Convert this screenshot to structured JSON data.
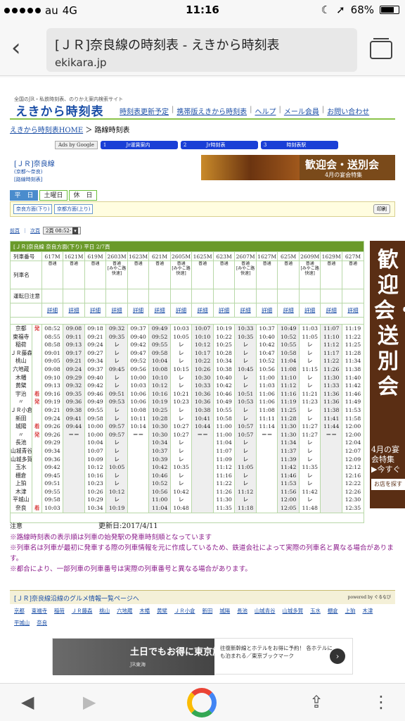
{
  "status": {
    "carrier": "au",
    "network": "4G",
    "time": "11:16",
    "battery": "68%",
    "battery_level": 0.68
  },
  "browser": {
    "title": "[ＪＲ]奈良線の時刻表 - えきから時刻表",
    "url": "ekikara.jp"
  },
  "site": {
    "tagline": "全国のJR・私鉄時刻表、のりかえ案内検索サイト",
    "logo": "えきから時刻表",
    "nav": [
      "時刻表更新予定",
      "携帯版えきから時刻表",
      "ヘルプ",
      "メール会員",
      "お問い合わせ"
    ],
    "breadcrumb_home": "えきから時刻表HOME",
    "breadcrumb_sep": "＞",
    "breadcrumb_current": "路線時刻表",
    "ads_by": "Ads by Google",
    "ad_links": [
      "Jr運賃案内",
      "Jr時刻表",
      "時刻表駅"
    ],
    "ad_link_nums": [
      "1",
      "2",
      "3"
    ],
    "line_name": "[ＪＲ]奈良線",
    "line_sub": "(京都～奈良)",
    "line_map": "[路線時刻表]",
    "banner_title": "歓迎会・送別会",
    "banner_sub": "4月の宴会特集",
    "day_tabs": [
      "平　日",
      "土曜日",
      "休　日"
    ],
    "dir_buttons": [
      "奈良方面(下り)",
      "京都方面(上り)"
    ],
    "print": "印刷",
    "pager_prev": "前頁",
    "pager_sep": "｜",
    "pager_next": "次頁",
    "pager_select": "2頁 08:52-"
  },
  "timetable": {
    "header": "[ＪＲ]奈良線 奈良方面(下り) 平日 2/7頁",
    "row_labels": {
      "train_no": "列車番号",
      "train_name": "列車名",
      "notice": "運転日注意",
      "detail": ""
    },
    "trains": [
      {
        "no": "617M",
        "type": "普通",
        "name": "",
        "detail": "詳細"
      },
      {
        "no": "1621M",
        "type": "普通",
        "name": "",
        "detail": "詳細"
      },
      {
        "no": "619M",
        "type": "普通",
        "name": "",
        "detail": "詳細"
      },
      {
        "no": "2603M",
        "type": "普通",
        "name": "[みやこ路快速]",
        "detail": "詳細"
      },
      {
        "no": "1623M",
        "type": "普通",
        "name": "",
        "detail": "詳細"
      },
      {
        "no": "621M",
        "type": "普通",
        "name": "",
        "detail": "詳細"
      },
      {
        "no": "2605M",
        "type": "普通",
        "name": "[みやこ路快速]",
        "detail": "詳細"
      },
      {
        "no": "1625M",
        "type": "普通",
        "name": "",
        "detail": "詳細"
      },
      {
        "no": "623M",
        "type": "普通",
        "name": "",
        "detail": "詳細"
      },
      {
        "no": "2607M",
        "type": "普通",
        "name": "[みやこ路快速]",
        "detail": "詳細"
      },
      {
        "no": "1627M",
        "type": "普通",
        "name": "",
        "detail": "詳細"
      },
      {
        "no": "625M",
        "type": "普通",
        "name": "",
        "detail": "詳細"
      },
      {
        "no": "2609M",
        "type": "普通",
        "name": "[みやこ路快速]",
        "detail": "詳細"
      },
      {
        "no": "1629M",
        "type": "普通",
        "name": "",
        "detail": "詳細"
      },
      {
        "no": "627M",
        "type": "普通",
        "name": "",
        "detail": "詳細"
      }
    ],
    "stations": [
      "京都",
      "東福寺",
      "稲荷",
      "ＪＲ藤森",
      "桃山",
      "六地蔵",
      "木幡",
      "黄檗",
      "宇治",
      "〃",
      "ＪＲ小倉",
      "新田",
      "城陽",
      "〃",
      "長池",
      "山城青谷",
      "山城多賀",
      "玉水",
      "棚倉",
      "上狛",
      "木津",
      "平城山",
      "奈良"
    ],
    "marks": [
      "発",
      "",
      "",
      "",
      "",
      "",
      "",
      "",
      "着",
      "発",
      "",
      "",
      "着",
      "発",
      "",
      "",
      "",
      "",
      "",
      "",
      "",
      "",
      "着"
    ],
    "times": [
      [
        "08:52",
        "08:55",
        "08:58",
        "09:01",
        "09:05",
        "09:08",
        "09:10",
        "09:13",
        "09:16",
        "09:19",
        "09:21",
        "09:24",
        "09:26",
        "09:26",
        "09:29",
        "09:34",
        "09:36",
        "09:42",
        "09:45",
        "09:51",
        "09:55",
        "09:58",
        "10:03"
      ],
      [
        "09:08",
        "09:11",
        "09:13",
        "09:17",
        "09:21",
        "09:24",
        "09:29",
        "09:32",
        "09:35",
        "09:36",
        "09:38",
        "09:41",
        "09:44",
        "＝＝",
        "",
        "",
        "",
        "",
        "",
        "",
        "",
        "",
        ""
      ],
      [
        "09:18",
        "09:21",
        "09:24",
        "09:27",
        "09:34",
        "09:37",
        "09:40",
        "09:42",
        "09:46",
        "09:49",
        "09:55",
        "09:58",
        "10:00",
        "10:00",
        "10:04",
        "10:07",
        "10:09",
        "10:12",
        "10:16",
        "10:23",
        "10:26",
        "10:29",
        "10:34"
      ],
      [
        "09:32",
        "09:35",
        "レ",
        "レ",
        "レ",
        "09:45",
        "レ",
        "レ",
        "09:51",
        "09:53",
        "レ",
        "レ",
        "09:57",
        "09:57",
        "レ",
        "レ",
        "レ",
        "10:05",
        "レ",
        "レ",
        "10:12",
        "レ",
        "10:19"
      ],
      [
        "09:37",
        "09:40",
        "09:42",
        "09:47",
        "09:52",
        "09:56",
        "10:00",
        "10:03",
        "10:06",
        "10:06",
        "10:08",
        "10:11",
        "10:14",
        "＝＝",
        "",
        "",
        "",
        "",
        "",
        "",
        "",
        "",
        ""
      ],
      [
        "09:49",
        "09:52",
        "09:55",
        "09:58",
        "10:04",
        "10:08",
        "10:10",
        "10:12",
        "10:16",
        "10:19",
        "10:25",
        "10:28",
        "10:30",
        "10:30",
        "10:34",
        "10:37",
        "10:39",
        "10:42",
        "10:46",
        "10:52",
        "10:56",
        "11:00",
        "11:04"
      ],
      [
        "10:03",
        "10:05",
        "レ",
        "レ",
        "レ",
        "10:15",
        "レ",
        "レ",
        "10:21",
        "10:23",
        "レ",
        "レ",
        "10:27",
        "10:27",
        "レ",
        "レ",
        "レ",
        "10:35",
        "レ",
        "レ",
        "10:42",
        "レ",
        "10:48"
      ],
      [
        "10:07",
        "10:10",
        "10:12",
        "10:17",
        "10:22",
        "10:26",
        "10:30",
        "10:33",
        "10:36",
        "10:36",
        "10:38",
        "10:41",
        "10:44",
        "＝＝",
        "",
        "",
        "",
        "",
        "",
        "",
        "",
        "",
        ""
      ],
      [
        "10:19",
        "10:22",
        "10:25",
        "10:28",
        "10:34",
        "10:38",
        "10:40",
        "10:42",
        "10:46",
        "10:49",
        "10:55",
        "10:58",
        "11:00",
        "11:00",
        "11:04",
        "11:07",
        "11:09",
        "11:12",
        "11:16",
        "11:22",
        "11:26",
        "11:30",
        "11:35"
      ],
      [
        "10:33",
        "10:35",
        "レ",
        "レ",
        "レ",
        "10:45",
        "レ",
        "レ",
        "10:51",
        "10:53",
        "レ",
        "レ",
        "10:57",
        "10:57",
        "レ",
        "レ",
        "レ",
        "11:05",
        "レ",
        "レ",
        "11:12",
        "レ",
        "11:18"
      ],
      [
        "10:37",
        "10:40",
        "10:42",
        "10:47",
        "10:52",
        "10:56",
        "11:00",
        "11:03",
        "11:06",
        "11:06",
        "11:08",
        "11:11",
        "11:14",
        "＝＝",
        "",
        "",
        "",
        "",
        "",
        "",
        "",
        "",
        ""
      ],
      [
        "10:49",
        "10:52",
        "10:55",
        "10:58",
        "11:04",
        "11:08",
        "11:10",
        "11:12",
        "11:16",
        "11:19",
        "11:25",
        "11:28",
        "11:30",
        "11:30",
        "11:34",
        "11:37",
        "11:39",
        "11:42",
        "11:46",
        "11:53",
        "11:56",
        "12:00",
        "12:05"
      ],
      [
        "11:03",
        "11:05",
        "レ",
        "レ",
        "レ",
        "11:15",
        "レ",
        "レ",
        "11:21",
        "11:23",
        "レ",
        "レ",
        "11:27",
        "11:27",
        "レ",
        "レ",
        "レ",
        "11:35",
        "レ",
        "レ",
        "11:42",
        "レ",
        "11:48"
      ],
      [
        "11:07",
        "11:10",
        "11:12",
        "11:17",
        "11:22",
        "11:26",
        "11:30",
        "11:33",
        "11:36",
        "11:36",
        "11:38",
        "11:41",
        "11:44",
        "＝＝",
        "",
        "",
        "",
        "",
        "",
        "",
        "",
        "",
        ""
      ],
      [
        "11:19",
        "11:22",
        "11:25",
        "11:28",
        "11:34",
        "11:38",
        "11:40",
        "11:42",
        "11:46",
        "11:49",
        "11:53",
        "11:58",
        "12:00",
        "12:00",
        "12:04",
        "12:07",
        "12:09",
        "12:12",
        "12:16",
        "12:22",
        "12:26",
        "12:30",
        "12:35"
      ]
    ]
  },
  "side_ad": {
    "text": "歓迎会・送別会",
    "sub": "4月の宴会特集",
    "sub2": "▶今すぐ",
    "btn": "お店を探す"
  },
  "notes": {
    "label": "注意",
    "updated": "更新日:2017/4/11",
    "lines": [
      "※路線時刻表の表示順は列車の始発駅の発車時刻順となっています",
      "※列車名は列車が最初に発車する際の列車情報を元に作成しているため、鉄道会社によって実際の列車名と異なる場合があります。",
      "※都合により、一部列車の列車番号は実際の列車番号と異なる場合があります。"
    ]
  },
  "gourmet": {
    "title": "[ＪＲ]奈良線沿線のグルメ情報一覧ページへ",
    "powered": "powered by ぐるなび",
    "stations": [
      "京都",
      "東福寺",
      "稲荷",
      "ＪＲ藤森",
      "桃山",
      "六地蔵",
      "木幡",
      "黄檗",
      "ＪＲ小倉",
      "新田",
      "城陽",
      "長池",
      "山城青谷",
      "山城多賀",
      "玉水",
      "棚倉",
      "上狛",
      "木津",
      "平城山",
      "奈良"
    ]
  },
  "bottom_ad": {
    "title": "土日でもお得に東京旅行",
    "sub": "JR東海",
    "text": "往復新幹線とホテルをお得に予約！ 各ホテルにも泊まれる／東京ブックマーク"
  }
}
